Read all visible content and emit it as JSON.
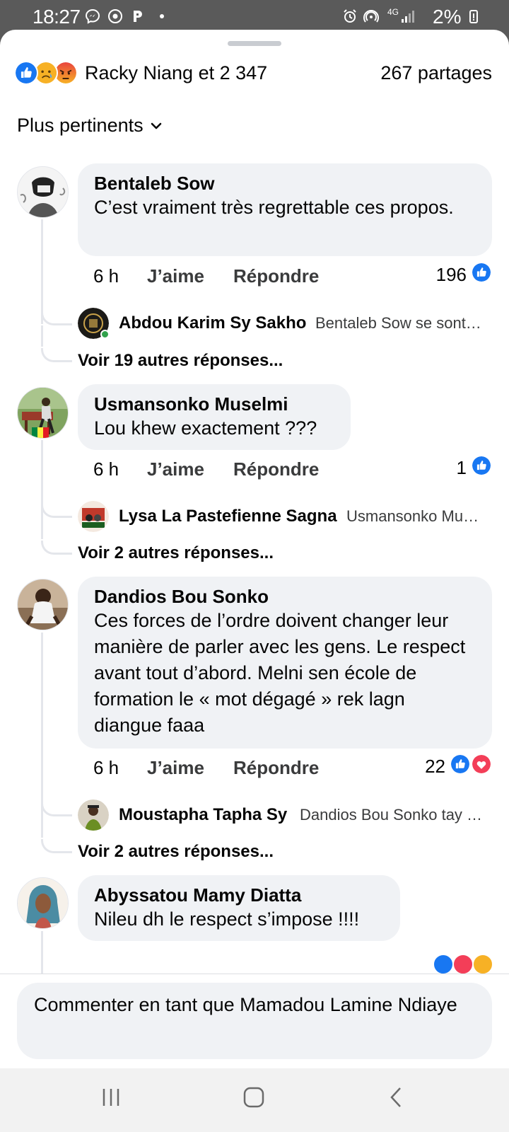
{
  "status_bar": {
    "time": "18:27",
    "network": "4G",
    "battery": "2%"
  },
  "header": {
    "reactors": "Racky Niang et 2 347",
    "shares": "267 partages",
    "reaction_icons": [
      "like-icon",
      "sad-icon",
      "angry-icon"
    ]
  },
  "sort": {
    "label": "Plus pertinents"
  },
  "comments": [
    {
      "author": "Bentaleb Sow",
      "text": "C’est vraiment très regrettable ces propos.",
      "time": "6 h",
      "like_label": "J’aime",
      "reply_label": "Répondre",
      "reaction_count": "196",
      "reply_preview": {
        "author": "Abdou Karim Sy Sakho",
        "snippet": "Bentaleb Sow se sont…"
      },
      "more_replies": "Voir 19 autres réponses..."
    },
    {
      "author": "Usmansonko Muselmi",
      "text": "Lou khew exactement ???",
      "time": "6 h",
      "like_label": "J’aime",
      "reply_label": "Répondre",
      "reaction_count": "1",
      "reply_preview": {
        "author": "Lysa La Pastefienne Sagna",
        "snippet": "Usmansonko Mu…"
      },
      "more_replies": "Voir 2 autres réponses..."
    },
    {
      "author": "Dandios Bou Sonko",
      "text": "Ces forces de l’ordre doivent changer leur manière de parler avec les gens. Le respect avant tout d’abord. Melni sen école de formation le « mot dégagé » rek lagn diangue faaa",
      "time": "6 h",
      "like_label": "J’aime",
      "reply_label": "Répondre",
      "reaction_count": "22",
      "reply_preview": {
        "author": "Moustapha Tapha Sy",
        "snippet": "Dandios Bou Sonko tay …"
      },
      "more_replies": "Voir 2 autres réponses..."
    },
    {
      "author": "Abyssatou Mamy Diatta",
      "text": "Nileu dh le respect s’impose !!!!"
    }
  ],
  "composer": {
    "placeholder": "Commenter en tant que Mamadou Lamine Ndiaye"
  },
  "colors": {
    "like_blue": "#1877f2",
    "love_red": "#f33e58",
    "bubble_gray": "#f0f2f5"
  }
}
